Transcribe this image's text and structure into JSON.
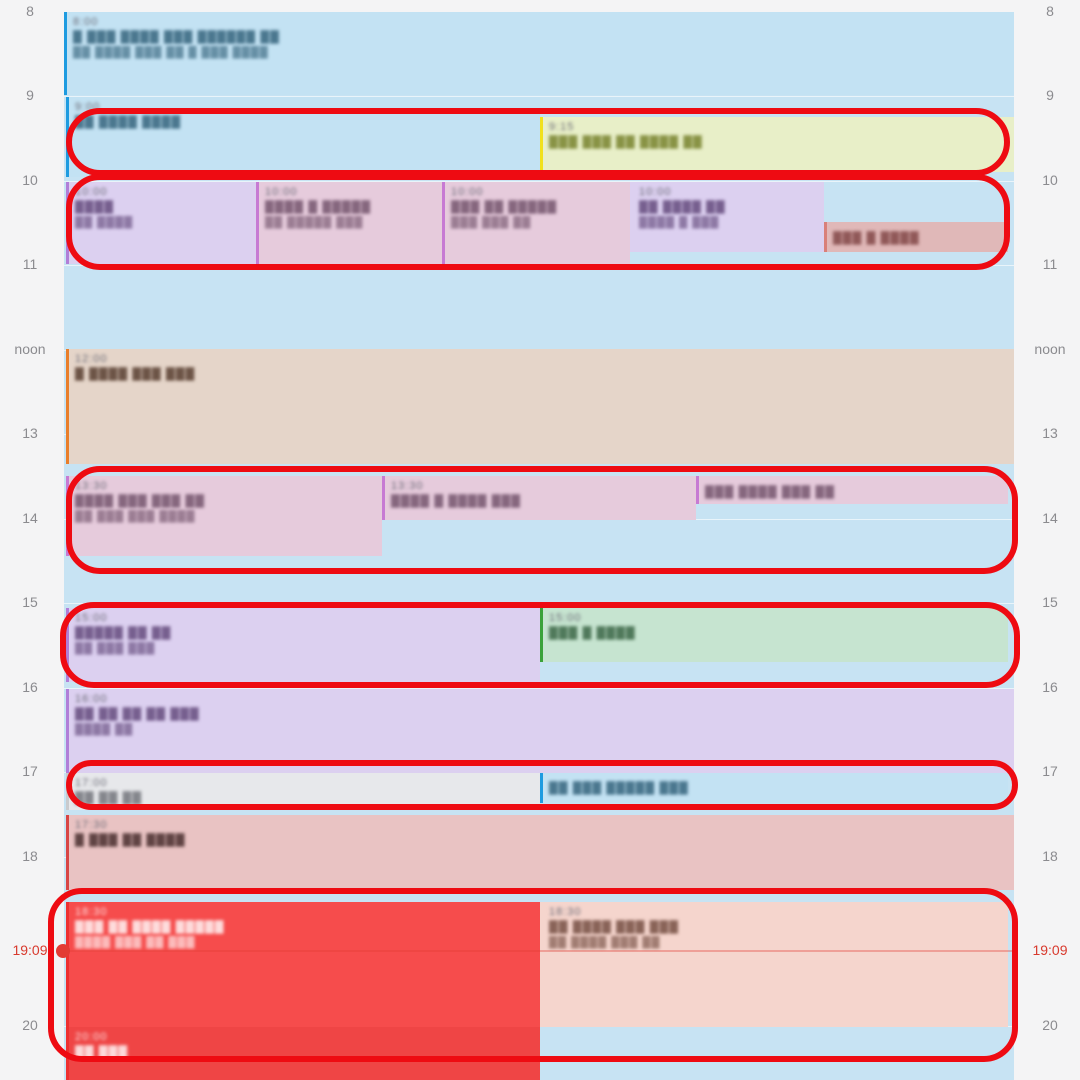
{
  "hours_left": [
    "8",
    "9",
    "10",
    "11",
    "noon",
    "13",
    "14",
    "15",
    "16",
    "17",
    "18",
    "19:09",
    "20"
  ],
  "hours_right": [
    "8",
    "9",
    "10",
    "11",
    "noon",
    "13",
    "14",
    "15",
    "16",
    "17",
    "18",
    "19:09",
    "20"
  ],
  "now_label": "19:09",
  "events": {
    "e1": {
      "time": "8:00",
      "title": "▓ ▓▓▓ ▓▓▓▓ ▓▓▓ ▓▓▓▓▓▓ ▓▓",
      "note": "▓▓ ▓▓▓▓ ▓▓▓ ▓▓ ▓ ▓▓▓ ▓▓▓▓"
    },
    "e2": {
      "time": "9:00",
      "title": "▓▓ ▓▓▓▓ ▓▓▓▓",
      "note": ""
    },
    "e3": {
      "time": "9:15",
      "title": "▓▓▓ ▓▓▓ ▓▓ ▓▓▓▓ ▓▓",
      "note": ""
    },
    "e4": {
      "time": "10:00",
      "title": "▓▓▓▓",
      "note": "▓▓ ▓▓▓▓"
    },
    "e5": {
      "time": "10:00",
      "title": "▓▓▓▓ ▓ ▓▓▓▓▓",
      "note": "▓▓ ▓▓▓▓▓ ▓▓▓"
    },
    "e6": {
      "time": "10:00",
      "title": "▓▓▓ ▓▓ ▓▓▓▓▓",
      "note": "▓▓▓ ▓▓▓ ▓▓"
    },
    "e7": {
      "time": "10:00",
      "title": "▓▓ ▓▓▓▓ ▓▓",
      "note": "▓▓▓▓ ▓ ▓▓▓"
    },
    "e8": {
      "time": "10:30",
      "title": "▓▓▓ ▓ ▓▓▓▓",
      "note": ""
    },
    "e9": {
      "time": "12:00",
      "title": "▓ ▓▓▓▓ ▓▓▓ ▓▓▓",
      "note": ""
    },
    "e10": {
      "time": "13:30",
      "title": "▓▓▓▓ ▓▓▓ ▓▓▓ ▓▓",
      "note": "▓▓ ▓▓▓ ▓▓▓ ▓▓▓▓"
    },
    "e11": {
      "time": "13:30",
      "title": "▓▓▓▓ ▓ ▓▓▓▓ ▓▓▓",
      "note": ""
    },
    "e12": {
      "time": "13:30",
      "title": "▓▓▓ ▓▓▓▓ ▓▓▓ ▓▓",
      "note": ""
    },
    "e13": {
      "time": "15:00",
      "title": "▓▓▓▓▓ ▓▓ ▓▓",
      "note": "▓▓ ▓▓▓ ▓▓▓"
    },
    "e14": {
      "time": "15:00",
      "title": "▓▓▓ ▓ ▓▓▓▓",
      "note": ""
    },
    "e15": {
      "time": "16:00",
      "title": "▓▓ ▓▓ ▓▓ ▓▓ ▓▓▓",
      "note": "▓▓▓▓ ▓▓"
    },
    "e16": {
      "time": "17:00",
      "title": "▓▓ ▓▓ ▓▓",
      "note": ""
    },
    "e17": {
      "time": "17:00",
      "title": "▓▓ ▓▓▓ ▓▓▓▓▓ ▓▓▓",
      "note": ""
    },
    "e18": {
      "time": "17:30",
      "title": "▓ ▓▓▓ ▓▓ ▓▓▓▓",
      "note": ""
    },
    "e19": {
      "time": "18:30",
      "title": "▓▓▓ ▓▓ ▓▓▓▓ ▓▓▓▓▓",
      "note": "▓▓▓▓ ▓▓▓ ▓▓ ▓▓▓"
    },
    "e20": {
      "time": "18:30",
      "title": "▓▓ ▓▓▓▓ ▓▓▓ ▓▓▓",
      "note": "▓▓ ▓▓▓▓ ▓▓▓ ▓▓"
    },
    "e21": {
      "time": "20:00",
      "title": "▓▓ ▓▓▓",
      "note": ""
    }
  }
}
